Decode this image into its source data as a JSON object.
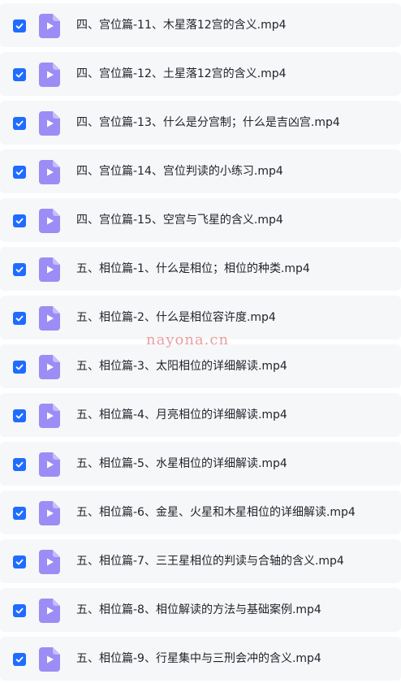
{
  "files": [
    {
      "name": "四、宫位篇-11、木星落12宫的含义.mp4",
      "checked": true
    },
    {
      "name": "四、宫位篇-12、土星落12宫的含义.mp4",
      "checked": true
    },
    {
      "name": "四、宫位篇-13、什么是分宫制；什么是吉凶宫.mp4",
      "checked": true
    },
    {
      "name": "四、宫位篇-14、宫位判读的小练习.mp4",
      "checked": true
    },
    {
      "name": "四、宫位篇-15、空宫与飞星的含义.mp4",
      "checked": true
    },
    {
      "name": "五、相位篇-1、什么是相位；相位的种类.mp4",
      "checked": true
    },
    {
      "name": "五、相位篇-2、什么是相位容许度.mp4",
      "checked": true
    },
    {
      "name": "五、相位篇-3、太阳相位的详细解读.mp4",
      "checked": true
    },
    {
      "name": "五、相位篇-4、月亮相位的详细解读.mp4",
      "checked": true
    },
    {
      "name": "五、相位篇-5、水星相位的详细解读.mp4",
      "checked": true
    },
    {
      "name": "五、相位篇-6、金星、火星和木星相位的详细解读.mp4",
      "checked": true
    },
    {
      "name": "五、相位篇-7、三王星相位的判读与合轴的含义.mp4",
      "checked": true
    },
    {
      "name": "五、相位篇-8、相位解读的方法与基础案例.mp4",
      "checked": true
    },
    {
      "name": "五、相位篇-9、行星集中与三刑会冲的含义.mp4",
      "checked": true
    }
  ],
  "icons": {
    "checkbox": "check-icon",
    "file": "video-file-icon"
  },
  "colors": {
    "checkbox": "#1f6cff",
    "file_icon": "#9b8df5",
    "row_bg": "#f6f7f9"
  },
  "watermark": "nayona.cn"
}
